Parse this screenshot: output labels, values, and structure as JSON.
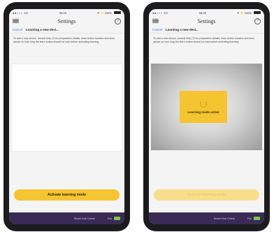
{
  "left_phone": {
    "status": {
      "carrier": "●●○○○ 3G",
      "time": "08:05",
      "right": "✈ ⚡ 100%"
    },
    "title": "Settings",
    "help_glyph": "?",
    "cancel_label": "Cancel",
    "subtitle": "Learning a new devi...",
    "instructions": "To add a new device, consult help (?) for preparation details, learn button location and area advice on how long the learn button should be held before activating learning.",
    "action_button_label": "Activate learning mode",
    "footer": {
      "brand": "Smart Hub Online",
      "fill_label": "Full"
    }
  },
  "right_phone": {
    "status": {
      "carrier": "●●○○○ 3G",
      "time": "08:05",
      "right": "✈ ⚡ 100%"
    },
    "title": "Settings",
    "help_glyph": "?",
    "cancel_label": "Cancel",
    "subtitle": "Learning a new devi...",
    "instructions": "To add a new device, consult help (?) for preparation details, learn button location and area advice on how long the learn button should be held before activating learning.",
    "overlay_label": "Learning mode active",
    "action_button_label": "Activate learning mode",
    "footer": {
      "brand": "Smart Hub Online",
      "fill_label": "Full"
    }
  },
  "colors": {
    "accent_yellow": "#f5c431",
    "footer_purple": "#3a2a55",
    "link_blue": "#3a7bd5",
    "fill_green": "#7ac943"
  },
  "icons": {
    "menu": "hamburger-icon",
    "help": "help-icon",
    "spinner": "spinner-icon",
    "battery": "battery-icon"
  }
}
